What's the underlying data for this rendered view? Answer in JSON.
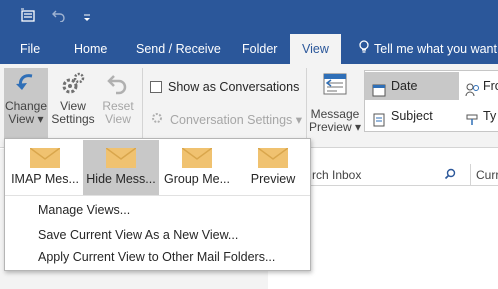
{
  "colors": {
    "accent": "#2b579a",
    "ribbon_bg": "#f3f3f3",
    "selected_bg": "#c8c8c8",
    "envelope": "#f0c270"
  },
  "qat": {
    "icons": [
      "send-receive-all-icon",
      "undo-icon",
      "customize-qat-icon"
    ]
  },
  "tabs": [
    {
      "label": "File"
    },
    {
      "label": "Home"
    },
    {
      "label": "Send / Receive"
    },
    {
      "label": "Folder"
    },
    {
      "label": "View"
    }
  ],
  "tell_me": {
    "icon": "lightbulb-icon",
    "label": "Tell me what you want"
  },
  "ribbon": {
    "change_view": {
      "line1": "Change",
      "line2": "View ▾"
    },
    "view_settings": {
      "line1": "View",
      "line2": "Settings"
    },
    "reset_view": {
      "line1": "Reset",
      "line2": "View"
    },
    "show_as_conversations": "Show as Conversations",
    "conversation_settings": "Conversation Settings ▾",
    "message_preview": {
      "line1": "Message",
      "line2": "Preview ▾"
    },
    "sort": {
      "date": "Date",
      "subject": "Subject",
      "from_partial": "Fro",
      "type_partial": "Ty"
    }
  },
  "search": {
    "placeholder_partial": "rch Inbox",
    "scope_partial": "Curr"
  },
  "change_view_menu": {
    "gallery": [
      {
        "label": "IMAP Mes..."
      },
      {
        "label": "Hide Mess...",
        "selected": true
      },
      {
        "label": "Group Me..."
      },
      {
        "label": "Preview"
      }
    ],
    "items": [
      {
        "label": "Manage Views..."
      },
      {
        "label": "Save Current View As a New View..."
      },
      {
        "label": "Apply Current View to Other Mail Folders..."
      }
    ]
  }
}
